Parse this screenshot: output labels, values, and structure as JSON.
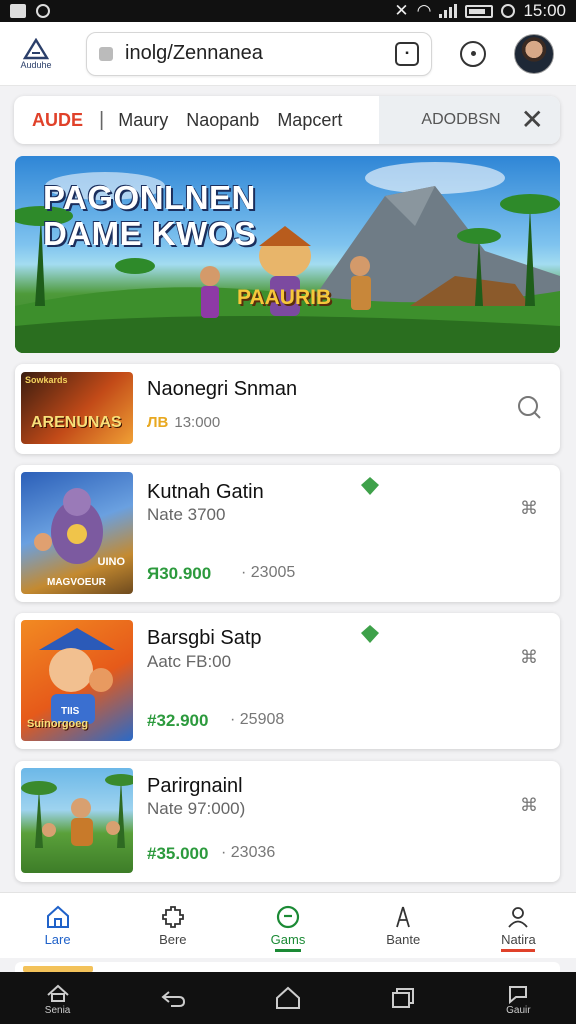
{
  "status_bar": {
    "time": "15:00"
  },
  "browser": {
    "logo_label": "Auduhe",
    "url": "inolg/Zennanea",
    "icons": [
      "logo-icon",
      "lock-icon",
      "tabs-icon",
      "shield-icon",
      "avatar"
    ]
  },
  "nav": {
    "brand": "AUDE",
    "links": [
      "Maury",
      "Naopanb",
      "Mapcert"
    ],
    "right_label": "ADODBSN"
  },
  "banner": {
    "title_line1": "PAGONLNEN",
    "title_line2": "DAME KWOS",
    "badge": "PAAURIB"
  },
  "games": [
    {
      "name": "Naonegri Snman",
      "thumb_text": "ARENUNAS",
      "thumb_top": "Sowkards",
      "rating_mark": "ЛB",
      "rating_text": "13:000"
    },
    {
      "name": "Kutnah Gatin",
      "sub": "Nate 3700",
      "price": "Я30.900",
      "count": "23005",
      "thumb_text": "MAGVOEUR",
      "thumb_top": "UINO"
    },
    {
      "name": "Barsgbi Satp",
      "sub": "Aatc FB:00",
      "price": "#32.900",
      "count": "25908",
      "thumb_text": "Suinorgoeg",
      "thumb_top": "TIIS"
    },
    {
      "name": "Parirgnainl",
      "sub": "Nate 97:000)",
      "price": "#35.000",
      "count": "23036"
    }
  ],
  "tabs": [
    {
      "label": "Lare",
      "icon": "home-icon"
    },
    {
      "label": "Bere",
      "icon": "puzzle-icon"
    },
    {
      "label": "Gams",
      "icon": "games-icon"
    },
    {
      "label": "Bante",
      "icon": "ranking-icon"
    },
    {
      "label": "Natira",
      "icon": "profile-icon"
    }
  ],
  "sysnav": {
    "first_label": "Senia",
    "last_label": "Gauir"
  },
  "colors": {
    "accent_red": "#e0412a",
    "price_green": "#2c9a3d",
    "home_blue": "#2062c9"
  }
}
